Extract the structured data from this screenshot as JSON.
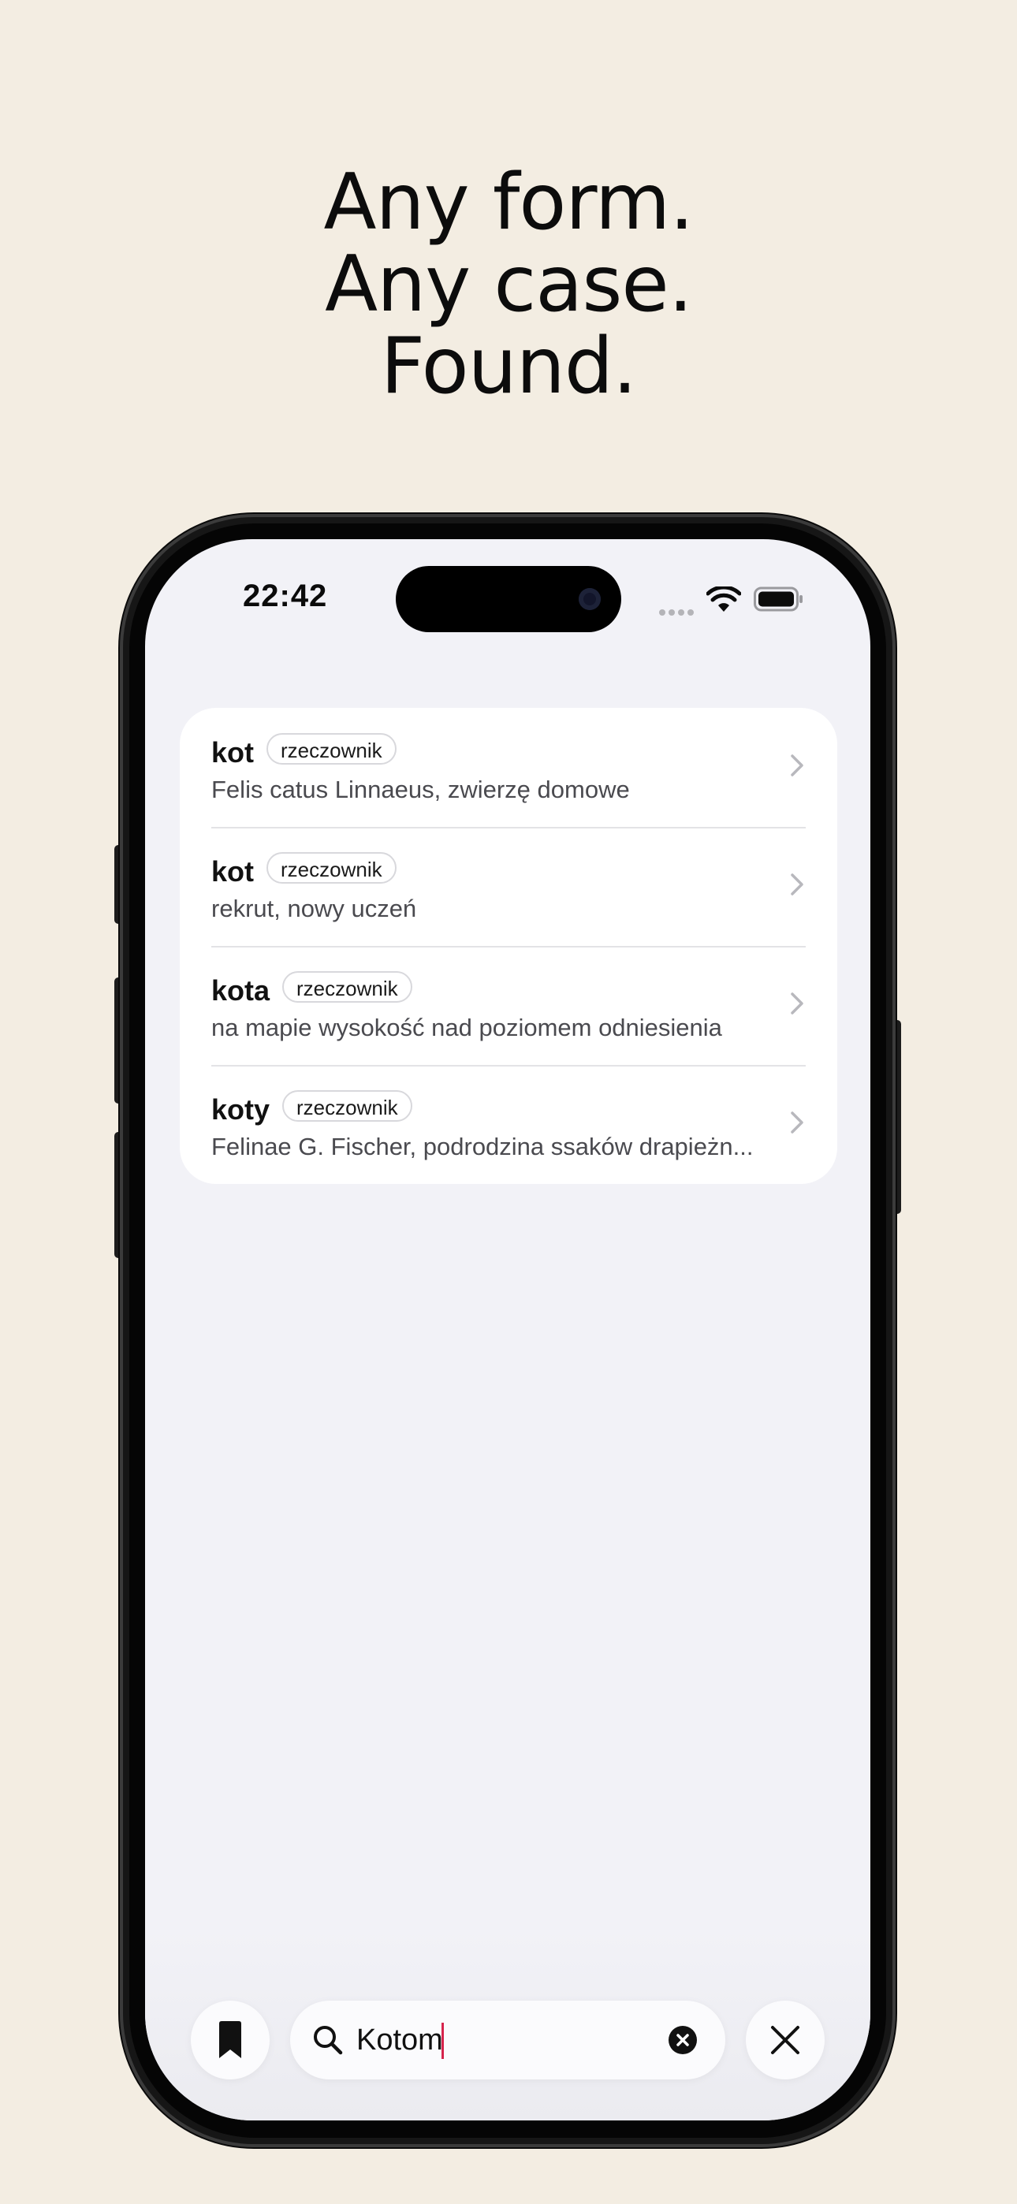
{
  "headline": {
    "line1": "Any form.",
    "line2": "Any case.",
    "line3": "Found."
  },
  "status_bar": {
    "time": "22:42"
  },
  "results": [
    {
      "word": "kot",
      "pos": "rzeczownik",
      "definition": "Felis catus Linnaeus, zwierzę domowe"
    },
    {
      "word": "kot",
      "pos": "rzeczownik",
      "definition": "rekrut, nowy uczeń"
    },
    {
      "word": "kota",
      "pos": "rzeczownik",
      "definition": "na mapie wysokość nad poziomem odniesienia"
    },
    {
      "word": "koty",
      "pos": "rzeczownik",
      "definition": "Felinae G. Fischer, podrodzina ssaków drapieżn..."
    }
  ],
  "search": {
    "value": "Kotom"
  },
  "icons": {
    "bookmark": "bookmark-icon",
    "search": "search-icon",
    "clear": "clear-circle-icon",
    "close": "close-icon",
    "chevron": "chevron-right-icon",
    "wifi": "wifi-icon",
    "battery": "battery-icon"
  },
  "colors": {
    "background": "#f3ede2",
    "caret": "#d6244c"
  }
}
